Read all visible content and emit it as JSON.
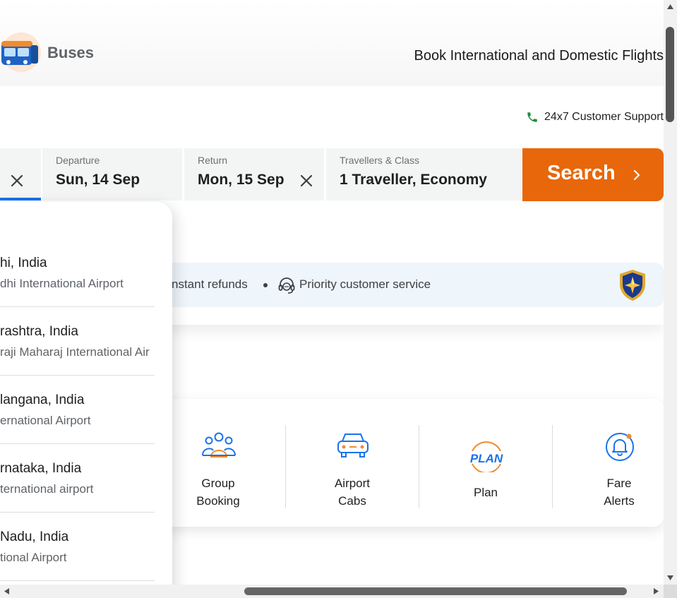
{
  "header": {
    "brand_label": "Buses",
    "tagline": "Book International and Domestic Flights"
  },
  "support": {
    "label": "24x7 Customer Support"
  },
  "search_form": {
    "departure": {
      "label": "Departure",
      "value": "Sun, 14 Sep"
    },
    "return": {
      "label": "Return",
      "value": "Mon, 15 Sep"
    },
    "travellers": {
      "label": "Travellers & Class",
      "value": "1 Traveller, Economy"
    },
    "search_button": "Search"
  },
  "benefits": {
    "item1": "nstant refunds",
    "item2": "Priority customer service"
  },
  "services": [
    {
      "label": "Group\nBooking",
      "icon": "group-icon"
    },
    {
      "label": "Airport\nCabs",
      "icon": "car-icon"
    },
    {
      "label": "Plan",
      "icon": "plan-icon"
    },
    {
      "label": "Fare\nAlerts",
      "icon": "bell-icon"
    }
  ],
  "dropdown": {
    "items": [
      {
        "city": "hi, India",
        "airport": "dhi International Airport"
      },
      {
        "city": "rashtra, India",
        "airport": "raji Maharaj International Air"
      },
      {
        "city": "langana, India",
        "airport": "ernational Airport"
      },
      {
        "city": "rnataka, India",
        "airport": "ternational airport"
      },
      {
        "city": " Nadu, India",
        "airport": "tional Airport"
      }
    ]
  },
  "colors": {
    "accent_orange": "#e8670a",
    "accent_blue": "#1a73e8",
    "field_bg": "#f3f4f4",
    "benefit_bg": "#eef5fb"
  }
}
